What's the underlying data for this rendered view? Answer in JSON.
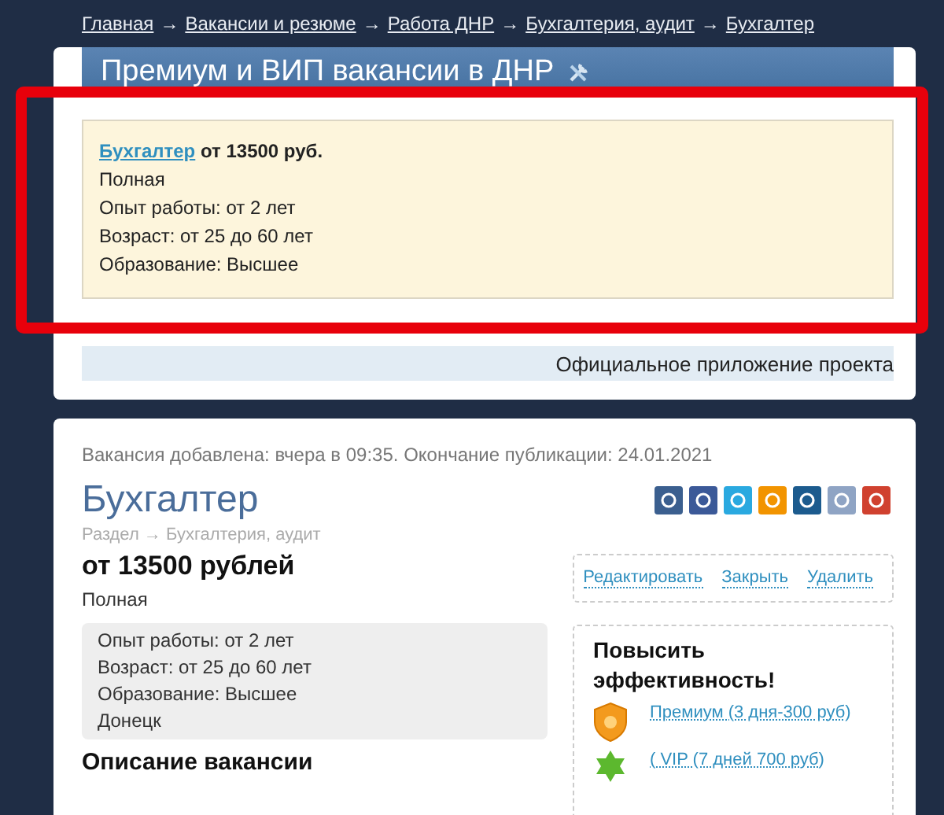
{
  "breadcrumb": [
    {
      "kind": "link",
      "text": "Главная"
    },
    {
      "kind": "separator",
      "text": "→"
    },
    {
      "kind": "link",
      "text": "Вакансии и резюме"
    },
    {
      "kind": "separator",
      "text": "→"
    },
    {
      "kind": "link",
      "text": "Работа ДНР"
    },
    {
      "kind": "separator",
      "text": "→"
    },
    {
      "kind": "link",
      "text": "Бухгалтерия, аудит"
    },
    {
      "kind": "separator",
      "text": "→"
    },
    {
      "kind": "link",
      "text": "Бухгалтер"
    }
  ],
  "premium_panel": {
    "title": "Премиум и ВИП вакансии в ДНР",
    "listing": {
      "title": "Бухгалтер",
      "salary": "от 13500 руб.",
      "lines": [
        "Полная",
        "Опыт работы: от 2 лет",
        "Возраст: от 25 до 60 лет",
        "Образование: Высшее"
      ]
    }
  },
  "app_banner": "Официальное приложение проекта",
  "vacancy": {
    "meta": "Вакансия добавлена: вчера в 09:35. Окончание публикации: 24.01.2021",
    "title": "Бухгалтер",
    "section": "Раздел → Бухгалтерия, аудит",
    "salary": "от 13500 рублей",
    "employment": "Полная",
    "details": [
      "Опыт работы: от 2 лет",
      "Возраст: от 25 до 60 лет",
      "Образование: Высшее",
      "Донецк"
    ],
    "description_heading": "Описание вакансии"
  },
  "actions": [
    "Редактировать",
    "Закрыть",
    "Удалить"
  ],
  "promote": {
    "title": "Повысить эффективность!",
    "options": [
      {
        "kind": "premium",
        "label": "Премиум (3 дня-300 руб)"
      },
      {
        "kind": "vip",
        "label": "( VIP (7 дней 700 руб)"
      }
    ]
  }
}
